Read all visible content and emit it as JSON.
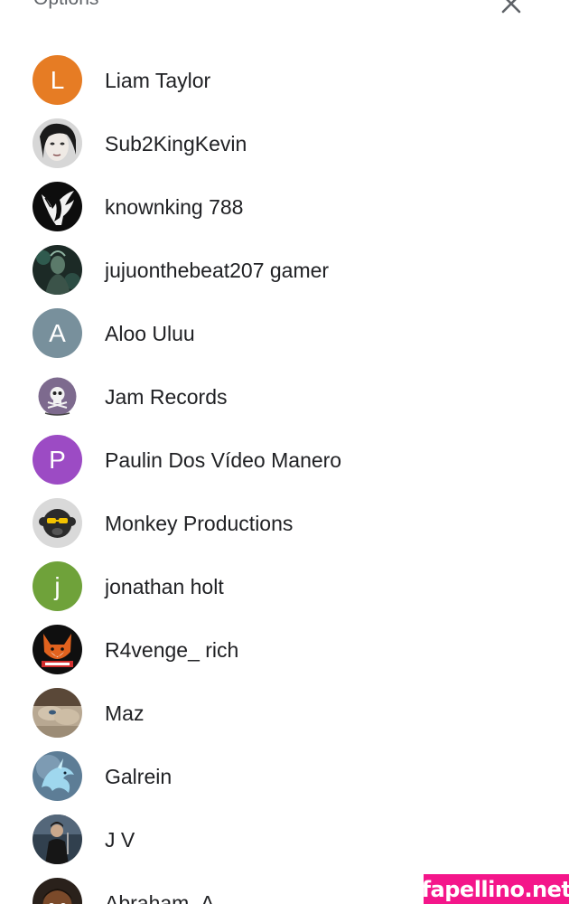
{
  "header": {
    "title": "Options",
    "close_icon": "close-icon"
  },
  "contacts": [
    {
      "name": "Liam Taylor",
      "initial": "L",
      "color": "#e67c24",
      "avatar": "letter"
    },
    {
      "name": "Sub2KingKevin",
      "avatar": "photo-face"
    },
    {
      "name": "knownking 788",
      "avatar": "photo-eagle"
    },
    {
      "name": "jujuonthebeat207 gamer",
      "avatar": "photo-dark-figure"
    },
    {
      "name": "Aloo Uluu",
      "initial": "A",
      "color": "#78909c",
      "avatar": "letter"
    },
    {
      "name": "Jam Records",
      "avatar": "photo-skull-logo"
    },
    {
      "name": "Paulin Dos Vídeo Manero",
      "initial": "P",
      "color": "#9c4bc4",
      "avatar": "letter"
    },
    {
      "name": "Monkey Productions",
      "avatar": "photo-monkey"
    },
    {
      "name": "jonathan holt",
      "initial": "j",
      "color": "#6fa23a",
      "avatar": "letter"
    },
    {
      "name": "R4venge_ rich",
      "avatar": "photo-fox-logo"
    },
    {
      "name": "Maz",
      "avatar": "photo-closeup"
    },
    {
      "name": "Galrein",
      "avatar": "photo-dragon"
    },
    {
      "name": "J V",
      "avatar": "photo-figure"
    },
    {
      "name": "Abraham_A",
      "avatar": "photo-cartoon-face"
    }
  ],
  "watermark": "fapellino.net"
}
